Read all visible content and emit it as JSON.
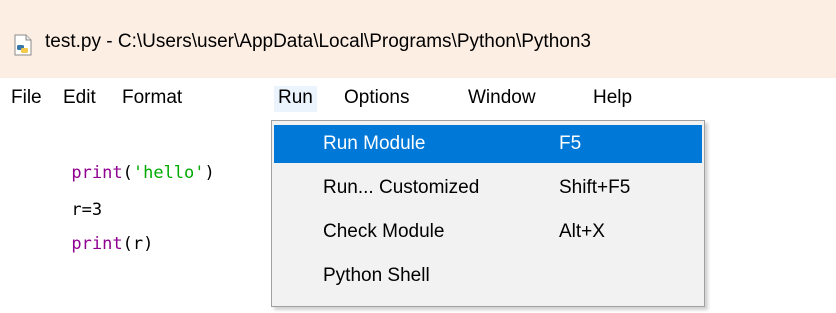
{
  "window": {
    "title": "test.py - C:\\Users\\user\\AppData\\Local\\Programs\\Python\\Python3",
    "icon": "python-file-icon"
  },
  "menubar": {
    "items": [
      {
        "label": "File"
      },
      {
        "label": "Edit"
      },
      {
        "label": "Format"
      },
      {
        "label": "Run"
      },
      {
        "label": "Options"
      },
      {
        "label": "Window"
      },
      {
        "label": "Help"
      }
    ],
    "active": "Run"
  },
  "editor": {
    "lines": [
      {
        "parts": [
          {
            "text": "print",
            "kind": "builtin"
          },
          {
            "text": "(",
            "kind": "plain"
          },
          {
            "text": "'hello'",
            "kind": "string"
          },
          {
            "text": ")",
            "kind": "plain"
          }
        ]
      },
      {
        "parts": [
          {
            "text": "r=3",
            "kind": "plain"
          }
        ]
      },
      {
        "parts": [
          {
            "text": "print",
            "kind": "builtin"
          },
          {
            "text": "(r)",
            "kind": "plain"
          }
        ]
      }
    ]
  },
  "run_menu": {
    "items": [
      {
        "label": "Run Module",
        "shortcut": "F5",
        "highlighted": true
      },
      {
        "label": "Run... Customized",
        "shortcut": "Shift+F5",
        "highlighted": false
      },
      {
        "label": "Check Module",
        "shortcut": "Alt+X",
        "highlighted": false
      },
      {
        "label": "Python Shell",
        "shortcut": "",
        "highlighted": false
      }
    ]
  },
  "colors": {
    "titlebar": "#fdeee4",
    "highlight": "#0078d7",
    "builtin": "#900090",
    "string": "#00aa00"
  }
}
